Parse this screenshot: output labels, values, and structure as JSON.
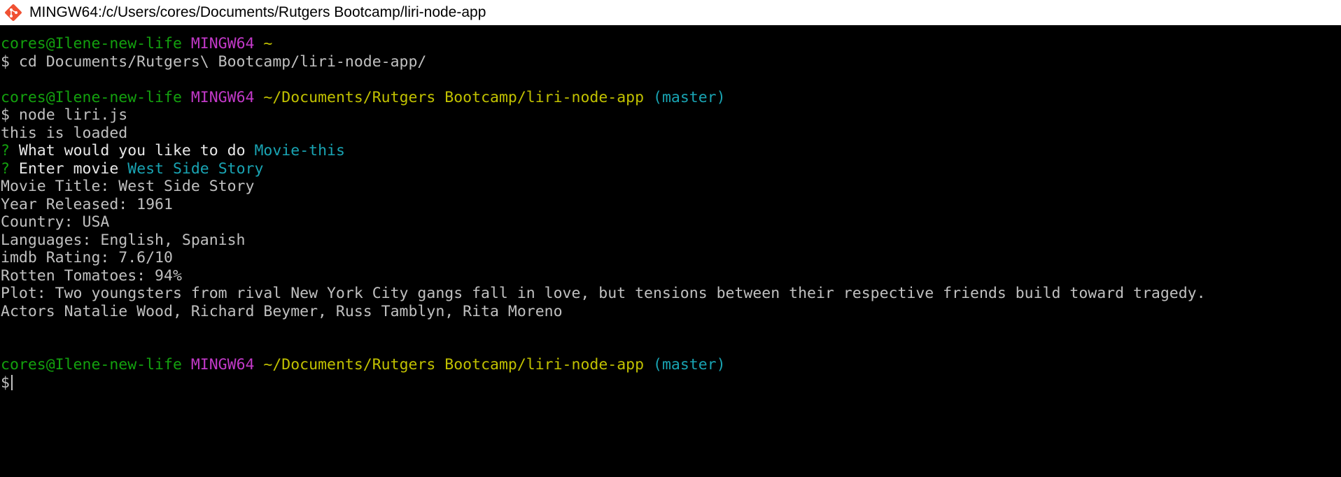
{
  "window": {
    "title": "MINGW64:/c/Users/cores/Documents/Rutgers Bootcamp/liri-node-app",
    "icon": "git-bash-icon"
  },
  "terminal": {
    "prompt1": {
      "user": "cores@Ilene-new-life",
      "shell": "MINGW64",
      "path": "~"
    },
    "cmd1": "$ cd Documents/Rutgers\\ Bootcamp/liri-node-app/",
    "prompt2": {
      "user": "cores@Ilene-new-life",
      "shell": "MINGW64",
      "path": "~/Documents/Rutgers Bootcamp/liri-node-app",
      "branch": "(master)"
    },
    "cmd2": "$ node liri.js",
    "loaded": "this is loaded",
    "question1": {
      "mark": "?",
      "text": "What would you like to do",
      "answer": "Movie-this"
    },
    "question2": {
      "mark": "?",
      "text": "Enter movie",
      "answer": "West Side Story"
    },
    "output": [
      "Movie Title: West Side Story",
      "Year Released: 1961",
      "Country: USA",
      "Languages: English, Spanish",
      "imdb Rating: 7.6/10",
      "Rotten Tomatoes: 94%",
      "Plot: Two youngsters from rival New York City gangs fall in love, but tensions between their respective friends build toward tragedy.",
      "Actors Natalie Wood, Richard Beymer, Russ Tamblyn, Rita Moreno"
    ],
    "prompt3": {
      "user": "cores@Ilene-new-life",
      "shell": "MINGW64",
      "path": "~/Documents/Rutgers Bootcamp/liri-node-app",
      "branch": "(master)"
    },
    "input_prompt": "$"
  },
  "colors": {
    "background": "#000000",
    "text": "#c0c0c0",
    "user": "#13a10e",
    "shell": "#c239c8",
    "path": "#c1c100",
    "branch": "#19a4b3"
  }
}
